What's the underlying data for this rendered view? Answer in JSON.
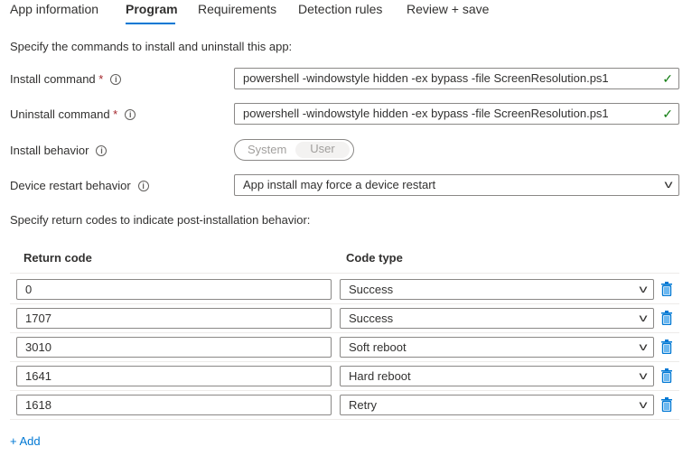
{
  "tabs": [
    {
      "label": "App information"
    },
    {
      "label": "Program"
    },
    {
      "label": "Requirements"
    },
    {
      "label": "Detection rules"
    },
    {
      "label": "Review + save"
    }
  ],
  "intro": "Specify the commands to install and uninstall this app:",
  "install_command": {
    "label": "Install command",
    "required": "*",
    "value": "powershell -windowstyle hidden -ex bypass -file ScreenResolution.ps1"
  },
  "uninstall_command": {
    "label": "Uninstall command",
    "required": "*",
    "value": "powershell -windowstyle hidden -ex bypass -file ScreenResolution.ps1"
  },
  "install_behavior": {
    "label": "Install behavior",
    "options": [
      "System",
      "User"
    ],
    "selected": "User"
  },
  "restart": {
    "label": "Device restart behavior",
    "value": "App install may force a device restart"
  },
  "return_intro": "Specify return codes to indicate post-installation behavior:",
  "table": {
    "headers": [
      "Return code",
      "Code type"
    ],
    "rows": [
      {
        "code": "0",
        "type": "Success"
      },
      {
        "code": "1707",
        "type": "Success"
      },
      {
        "code": "3010",
        "type": "Soft reboot"
      },
      {
        "code": "1641",
        "type": "Hard reboot"
      },
      {
        "code": "1618",
        "type": "Retry"
      }
    ]
  },
  "add_label": "+ Add",
  "colors": {
    "accent": "#0078d4",
    "check": "#107c10",
    "required": "#a4262c"
  }
}
